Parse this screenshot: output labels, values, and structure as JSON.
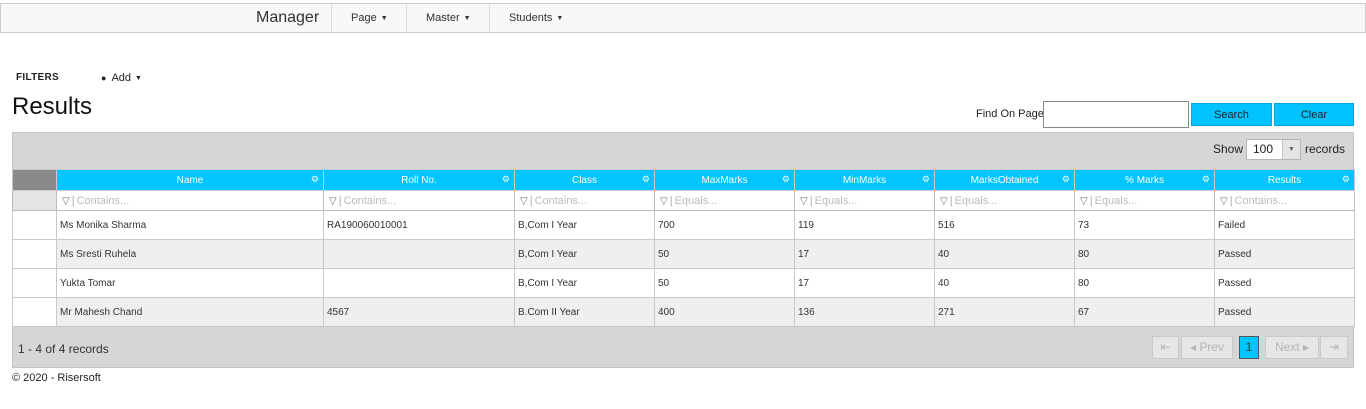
{
  "nav": {
    "brand": "Manager",
    "menus": [
      {
        "label": "Page"
      },
      {
        "label": "Master"
      },
      {
        "label": "Students"
      }
    ]
  },
  "filters": {
    "label": "FILTERS",
    "add_label": "Add"
  },
  "page": {
    "title": "Results"
  },
  "search": {
    "find_label": "Find On Page",
    "value": "",
    "placeholder": "",
    "search_button": "Search",
    "clear_button": "Clear"
  },
  "page_size": {
    "show_label": "Show",
    "value": "100",
    "records_label": "records"
  },
  "grid": {
    "columns": [
      {
        "header": "Name",
        "filter_placeholder": "Contains..."
      },
      {
        "header": "Roll No.",
        "filter_placeholder": "Contains..."
      },
      {
        "header": "Class",
        "filter_placeholder": "Contains..."
      },
      {
        "header": "MaxMarks",
        "filter_placeholder": "Equals..."
      },
      {
        "header": "MinMarks",
        "filter_placeholder": "Equals..."
      },
      {
        "header": "MarksObtained",
        "filter_placeholder": "Equals..."
      },
      {
        "header": "% Marks",
        "filter_placeholder": "Equals..."
      },
      {
        "header": "Results",
        "filter_placeholder": "Contains..."
      }
    ],
    "rows": [
      [
        "Ms Monika Sharma",
        "RA190060010001",
        "B,Com I Year",
        "700",
        "119",
        "516",
        "73",
        "Failed"
      ],
      [
        "Ms Sresti Ruhela",
        "",
        "B,Com I Year",
        "50",
        "17",
        "40",
        "80",
        "Passed"
      ],
      [
        "Yukta Tomar",
        "",
        "B,Com I Year",
        "50",
        "17",
        "40",
        "80",
        "Passed"
      ],
      [
        "Mr Mahesh Chand",
        "4567",
        "B.Com II Year",
        "400",
        "136",
        "271",
        "67",
        "Passed"
      ]
    ]
  },
  "pager": {
    "info": "1 - 4 of 4 records",
    "prev_label": "Prev",
    "next_label": "Next",
    "current_page": "1"
  },
  "footer": {
    "text": "© 2020 - Risersoft"
  },
  "colors": {
    "accent": "#00c5ff",
    "grid_bg": "#d6d6d6"
  }
}
